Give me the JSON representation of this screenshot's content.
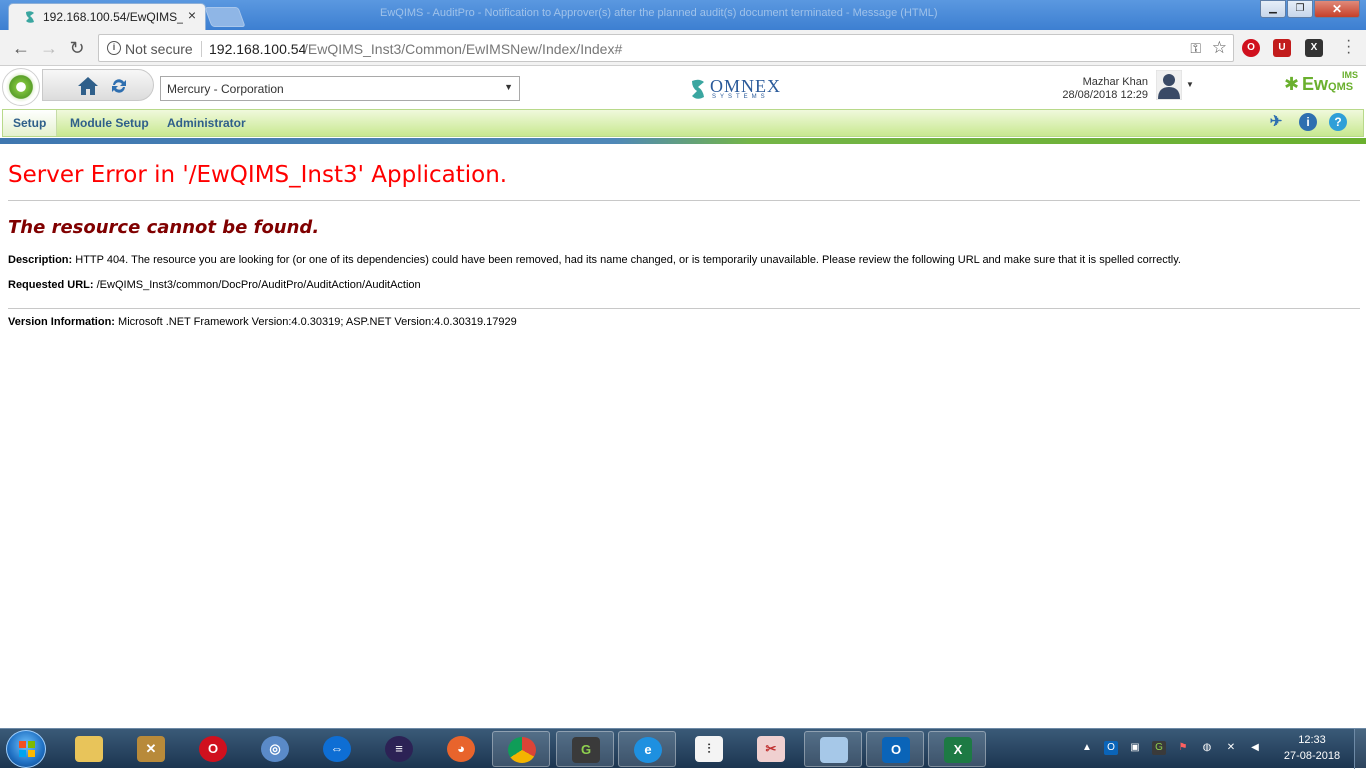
{
  "browser": {
    "tab_title": "192.168.100.54/EwQIMS_",
    "window_title": "EwQIMS - AuditPro - Notification to Approver(s) after the planned audit(s) document terminated - Message (HTML)",
    "not_secure": "Not secure",
    "url_host": "192.168.100.54",
    "url_path": "/EwQIMS_Inst3/Common/EwIMSNew/Index/Index#",
    "tab_close": "×",
    "win_minimize": "▁",
    "win_maximize": "❐",
    "win_close": "✕"
  },
  "app": {
    "company": "Mercury - Corporation",
    "vendor_name": "OMNEX",
    "vendor_sub": "SYSTEMS",
    "user_name": "Mazhar Khan",
    "user_datetime": "28/08/2018 12:29",
    "product_ew": "Ew",
    "product_qms": "QMS",
    "product_ims": "IMS",
    "menu": [
      "Setup",
      "Module Setup",
      "Administrator"
    ]
  },
  "error": {
    "title": "Server Error in '/EwQIMS_Inst3' Application.",
    "subtitle": "The resource cannot be found.",
    "description_label": "Description:",
    "description": "HTTP 404. The resource you are looking for (or one of its dependencies) could have been removed, had its name changed, or is temporarily unavailable.  Please review the following URL and make sure that it is spelled correctly.",
    "requested_label": "Requested URL:",
    "requested_url": "/EwQIMS_Inst3/common/DocPro/AuditPro/AuditAction/AuditAction",
    "version_label": "Version Information:",
    "version": "Microsoft .NET Framework Version:4.0.30319; ASP.NET Version:4.0.30319.17929"
  },
  "taskbar": {
    "apps": [
      "file-explorer-icon",
      "tools-icon",
      "opera-icon",
      "network-icon",
      "teamviewer-icon",
      "eclipse-icon",
      "firefox-icon",
      "chrome-icon",
      "notepad-plus-icon",
      "internet-explorer-icon",
      "chart-app-icon",
      "snipping-tool-icon",
      "notes-icon",
      "outlook-icon",
      "excel-icon"
    ],
    "clock_time": "12:33",
    "clock_date": "27-08-2018"
  },
  "colors": {
    "error_red": "#ff0000",
    "error_maroon": "#800000",
    "menu_text": "#2f5f8a",
    "brand_green": "#6ab02e"
  }
}
